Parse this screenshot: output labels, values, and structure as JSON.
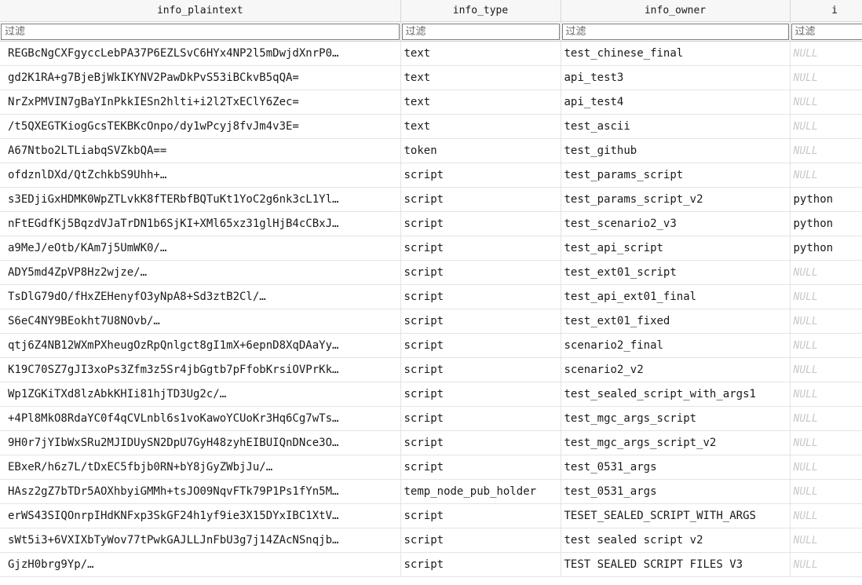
{
  "columns": [
    "info_plaintext",
    "info_type",
    "info_owner",
    "i"
  ],
  "filter_placeholder": "过滤",
  "null_label": "NULL",
  "rows": [
    {
      "plaintext": "REGBcNgCXFgyccLebPA37P6EZLSvC6HYx4NP2l5mDwjdXnrP0…",
      "type": "text",
      "owner": "test_chinese_final",
      "lang": null
    },
    {
      "plaintext": "gd2K1RA+g7BjeBjWkIKYNV2PawDkPvS53iBCkvB5qQA=",
      "type": "text",
      "owner": "api_test3",
      "lang": null
    },
    {
      "plaintext": "NrZxPMVIN7gBaYInPkkIESn2hlti+i2l2TxEClY6Zec=",
      "type": "text",
      "owner": "api_test4",
      "lang": null
    },
    {
      "plaintext": "/t5QXEGTKiogGcsTEKBKcOnpo/dy1wPcyj8fvJm4v3E=",
      "type": "text",
      "owner": "test_ascii",
      "lang": null
    },
    {
      "plaintext": "A67Ntbo2LTLiabqSVZkbQA==",
      "type": "token",
      "owner": "test_github",
      "lang": null
    },
    {
      "plaintext": "ofdznlDXd/QtZchkbS9Uhh+…",
      "type": "script",
      "owner": "test_params_script",
      "lang": null
    },
    {
      "plaintext": "s3EDjiGxHDMK0WpZTLvkK8fTERbfBQTuKt1YoC2g6nk3cL1Yl…",
      "type": "script",
      "owner": "test_params_script_v2",
      "lang": "python"
    },
    {
      "plaintext": "nFtEGdfKj5BqzdVJaTrDN1b6SjKI+XMl65xz31glHjB4cCBxJ…",
      "type": "script",
      "owner": "test_scenario2_v3",
      "lang": "python"
    },
    {
      "plaintext": "a9MeJ/eOtb/KAm7j5UmWK0/…",
      "type": "script",
      "owner": "test_api_script",
      "lang": "python"
    },
    {
      "plaintext": "ADY5md4ZpVP8Hz2wjze/…",
      "type": "script",
      "owner": "test_ext01_script",
      "lang": null
    },
    {
      "plaintext": "TsDlG79dO/fHxZEHenyfO3yNpA8+Sd3ztB2Cl/…",
      "type": "script",
      "owner": "test_api_ext01_final",
      "lang": null
    },
    {
      "plaintext": "S6eC4NY9BEokht7U8NOvb/…",
      "type": "script",
      "owner": "test_ext01_fixed",
      "lang": null
    },
    {
      "plaintext": "qtj6Z4NB12WXmPXheugOzRpQnlgct8gI1mX+6epnD8XqDAaYy…",
      "type": "script",
      "owner": "scenario2_final",
      "lang": null
    },
    {
      "plaintext": "K19C70SZ7gJI3xoPs3Zfm3z5Sr4jbGgtb7pFfobKrsiOVPrKk…",
      "type": "script",
      "owner": "scenario2_v2",
      "lang": null
    },
    {
      "plaintext": "Wp1ZGKiTXd8lzAbkKHIi81hjTD3Ug2c/…",
      "type": "script",
      "owner": "test_sealed_script_with_args1",
      "lang": null
    },
    {
      "plaintext": "+4Pl8MkO8RdaYC0f4qCVLnbl6s1voKawoYCUoKr3Hq6Cg7wTs…",
      "type": "script",
      "owner": "test_mgc_args_script",
      "lang": null
    },
    {
      "plaintext": "9H0r7jYIbWxSRu2MJIDUySN2DpU7GyH48zyhEIBUIQnDNce3O…",
      "type": "script",
      "owner": "test_mgc_args_script_v2",
      "lang": null
    },
    {
      "plaintext": "EBxeR/h6z7L/tDxEC5fbjb0RN+bY8jGyZWbjJu/…",
      "type": "script",
      "owner": "test_0531_args",
      "lang": null
    },
    {
      "plaintext": "HAsz2gZ7bTDr5AOXhbyiGMMh+tsJO09NqvFTk79P1Ps1fYn5M…",
      "type": "temp_node_pub_holder",
      "owner": "test_0531_args",
      "lang": null
    },
    {
      "plaintext": "erWS43SIQOnrpIHdKNFxp3SkGF24h1yf9ie3X15DYxIBC1XtV…",
      "type": "script",
      "owner": "TESET_SEALED_SCRIPT_WITH_ARGS",
      "lang": null
    },
    {
      "plaintext": "sWt5i3+6VXIXbTyWov77tPwkGAJLLJnFbU3g7j14ZAcNSnqjb…",
      "type": "script",
      "owner": "test sealed script v2",
      "lang": null
    },
    {
      "plaintext": "GjzH0brg9Yp/…",
      "type": "script",
      "owner": "TEST SEALED SCRIPT FILES V3",
      "lang": null
    }
  ]
}
